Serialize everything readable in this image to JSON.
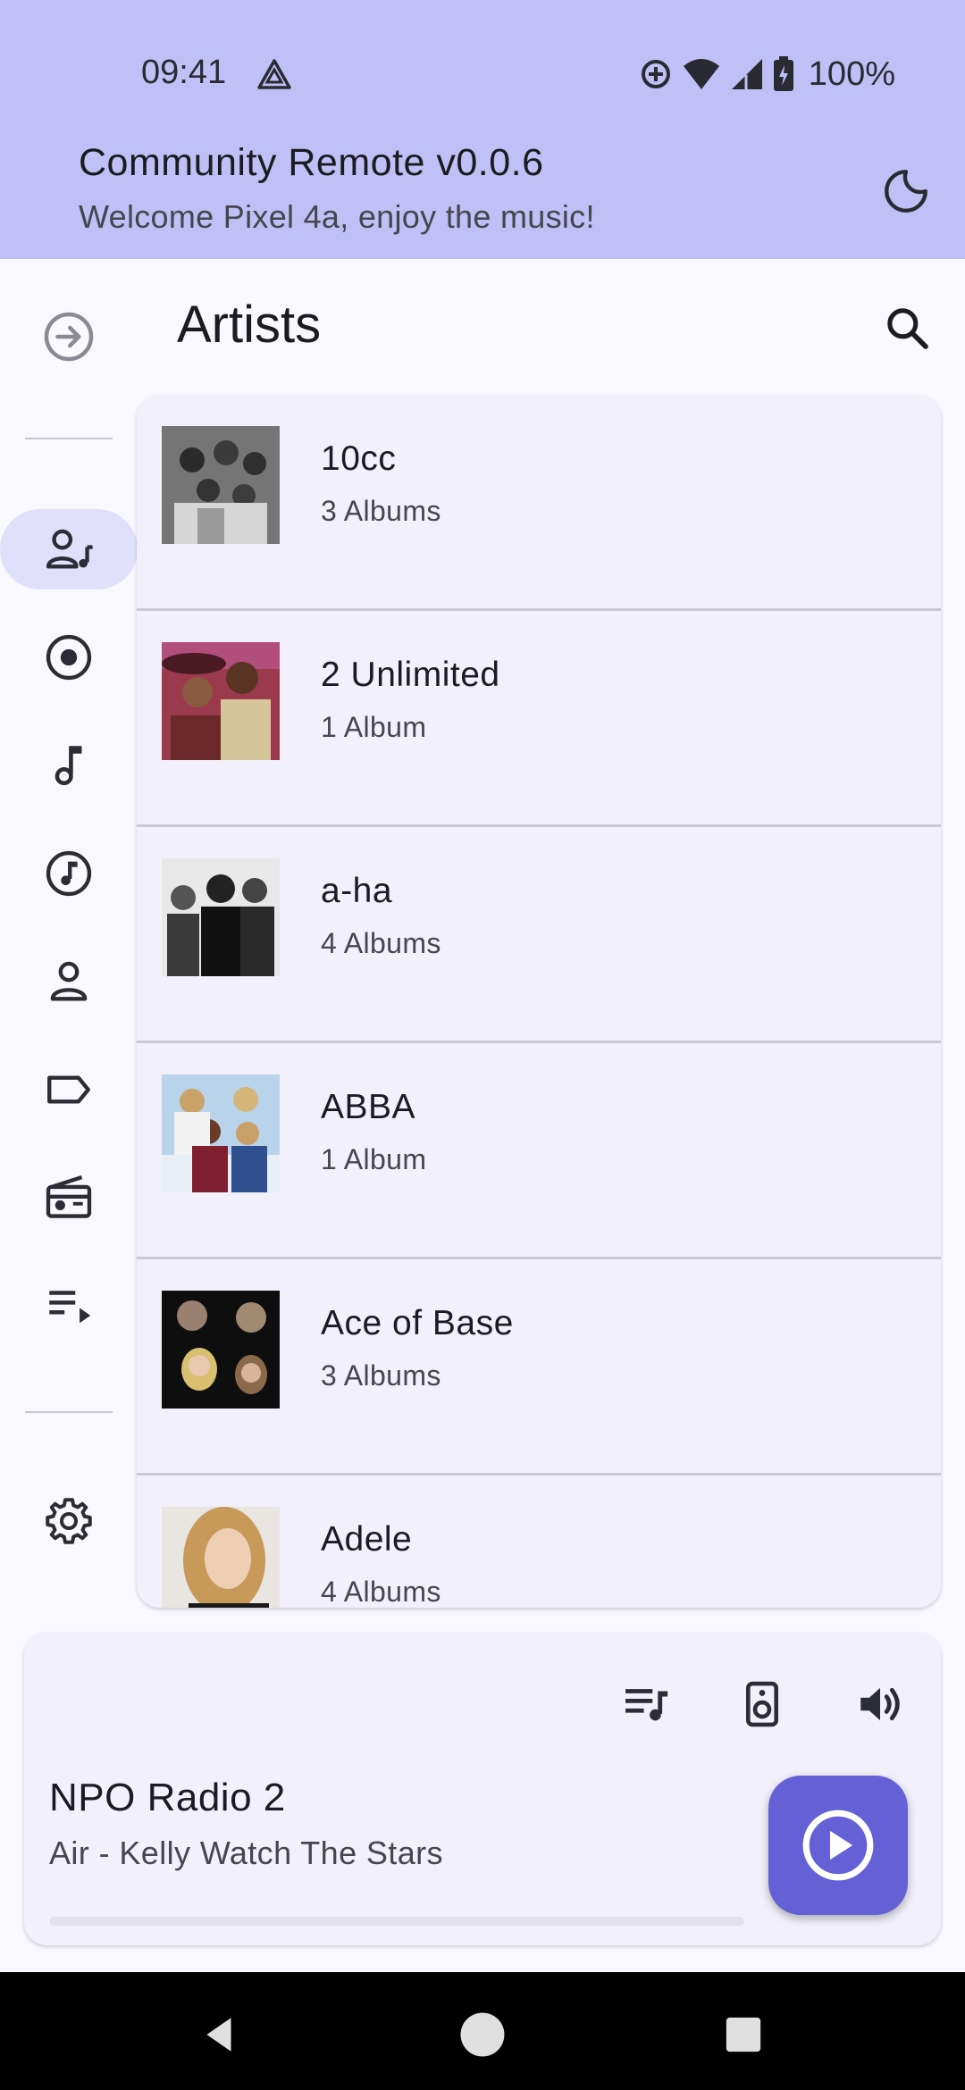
{
  "status_bar": {
    "time": "09:41",
    "battery": "100%",
    "icons": [
      "alert-triangle-icon",
      "data-saver-icon",
      "wifi-icon",
      "cell-signal-icon",
      "battery-charging-icon"
    ]
  },
  "header": {
    "title": "Community Remote v0.0.6",
    "subtitle": "Welcome Pixel 4a, enjoy the music!",
    "theme_icon": "moon-icon"
  },
  "nav_rail": {
    "expand_icon": "arrow-right-circle-icon",
    "items": [
      {
        "icon": "artist-icon",
        "active": true
      },
      {
        "icon": "album-icon",
        "active": false
      },
      {
        "icon": "music-note-icon",
        "active": false
      },
      {
        "icon": "music-circle-icon",
        "active": false
      },
      {
        "icon": "person-icon",
        "active": false
      },
      {
        "icon": "label-icon",
        "active": false
      },
      {
        "icon": "radio-icon",
        "active": false
      },
      {
        "icon": "playlist-play-icon",
        "active": false
      }
    ],
    "settings_icon": "gear-icon"
  },
  "page": {
    "title": "Artists",
    "search_icon": "search-icon"
  },
  "artists": [
    {
      "name": "10cc",
      "albums": "3 Albums"
    },
    {
      "name": "2 Unlimited",
      "albums": "1 Album"
    },
    {
      "name": "a-ha",
      "albums": "4 Albums"
    },
    {
      "name": "ABBA",
      "albums": "1 Album"
    },
    {
      "name": "Ace of Base",
      "albums": "3 Albums"
    },
    {
      "name": "Adele",
      "albums": "4 Albums"
    }
  ],
  "player": {
    "station": "NPO Radio 2",
    "track": "Air - Kelly Watch The Stars",
    "progress": 0.0,
    "controls": [
      "queue-music-icon",
      "speaker-icon",
      "volume-icon"
    ],
    "play_icon": "play-circle-icon"
  },
  "system_nav": {
    "buttons": [
      "back-icon",
      "home-icon",
      "recents-icon"
    ]
  },
  "colors": {
    "header_bg": "#c1c0f6",
    "accent": "#6361d5",
    "active_pill": "#e1e0fb",
    "card_bg": "#f2f1fb"
  }
}
